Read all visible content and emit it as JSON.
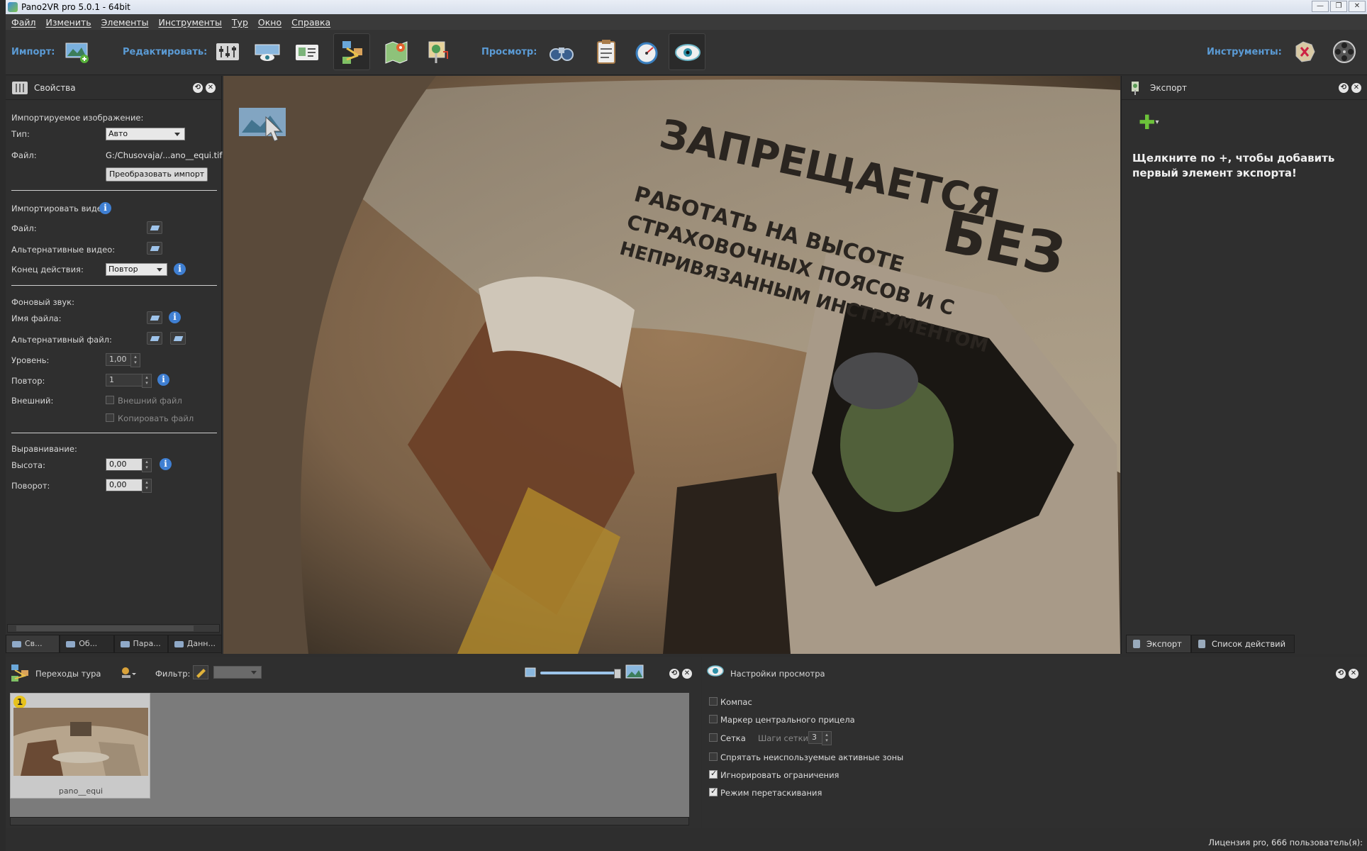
{
  "window": {
    "title": "Pano2VR pro 5.0.1 - 64bit"
  },
  "menu": [
    "Файл",
    "Изменить",
    "Элементы",
    "Инструменты",
    "Тур",
    "Окно",
    "Справка"
  ],
  "toolbar": {
    "import_label": "Импорт:",
    "edit_label": "Редактировать:",
    "view_label": "Просмотр:",
    "tools_label": "Инструменты:"
  },
  "properties": {
    "title": "Свойства",
    "imported_image_label": "Импортируемое изображение:",
    "type_label": "Тип:",
    "type_value": "Авто",
    "file_label": "Файл:",
    "file_value": "G:/Chusovaja/...ano__equi.tif",
    "convert_button": "Преобразовать импорт",
    "import_video_label": "Импортировать видео:",
    "video_file_label": "Файл:",
    "alt_video_label": "Альтернативные видео:",
    "end_action_label": "Конец действия:",
    "end_action_value": "Повтор",
    "bg_sound_label": "Фоновый звук:",
    "filename_label": "Имя файла:",
    "alt_file_label": "Альтернативный файл:",
    "level_label": "Уровень:",
    "level_value": "1,00",
    "repeat_label": "Повтор:",
    "repeat_value": "1",
    "external_label": "Внешний:",
    "external_file_label": "Внешний файл",
    "copy_file_label": "Копировать файл",
    "alignment_label": "Выравнивание:",
    "height_label": "Высота:",
    "height_value": "0,00",
    "rotation_label": "Поворот:",
    "rotation_value": "0,00"
  },
  "left_tabs": [
    "Св...",
    "Об...",
    "Пара...",
    "Данн..."
  ],
  "export": {
    "title": "Экспорт",
    "hint": "Щелкните по +, чтобы добавить первый элемент экспорта!",
    "tabs": [
      "Экспорт",
      "Список действий"
    ]
  },
  "tour": {
    "title": "Переходы тура",
    "filter_label": "Фильтр:",
    "node_badge": "1",
    "node_label": "pano__equi"
  },
  "view_settings": {
    "title": "Настройки просмотра",
    "items": [
      {
        "label": "Компас",
        "checked": false
      },
      {
        "label": "Маркер центрального прицела",
        "checked": false
      },
      {
        "label": "Сетка",
        "checked": false
      },
      {
        "label": "Спрятать неиспользуемые активные зоны",
        "checked": false
      },
      {
        "label": "Игнорировать ограничения",
        "checked": true
      },
      {
        "label": "Режим перетаскивания",
        "checked": true
      }
    ],
    "grid_steps_label": "Шаги сетки:",
    "grid_steps_value": "3"
  },
  "status": {
    "license": "Лицензия pro, 666 пользователь(я):"
  },
  "colors": {
    "accent": "#5b9bd5",
    "info": "#3f7fd2",
    "add": "#6cc23a"
  }
}
